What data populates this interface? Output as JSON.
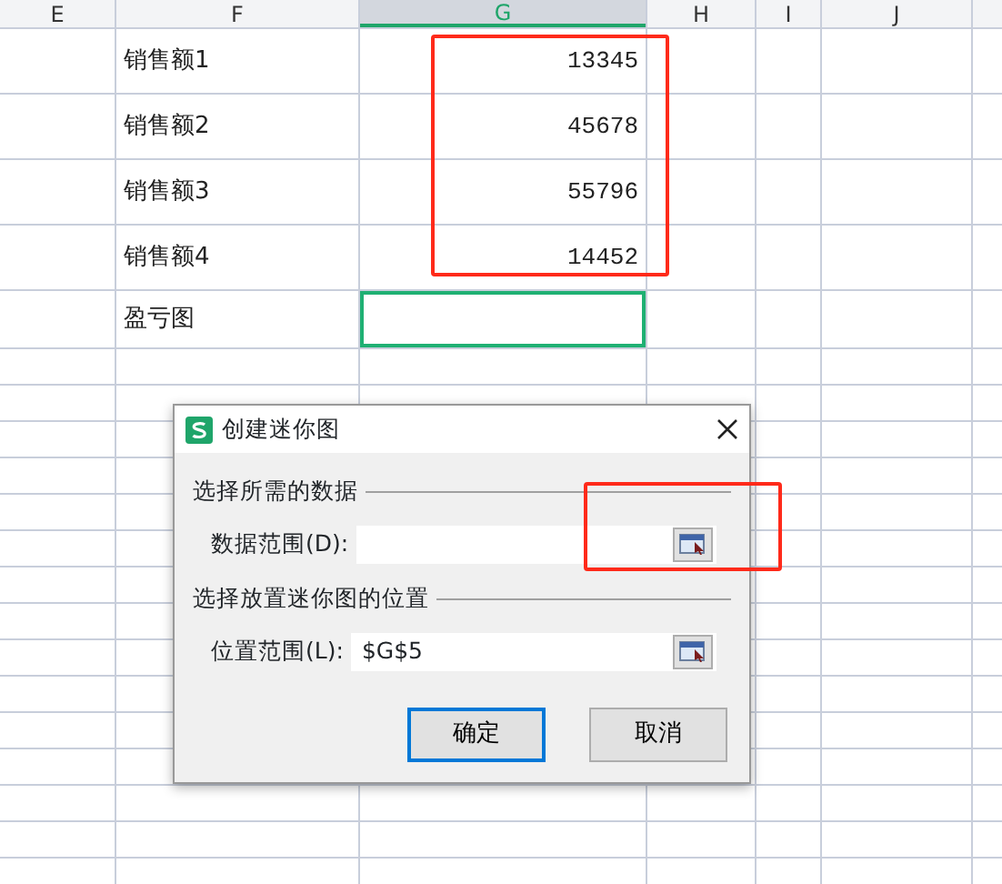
{
  "sheet": {
    "columns": [
      {
        "label": "E",
        "selected": false
      },
      {
        "label": "F",
        "selected": false
      },
      {
        "label": "G",
        "selected": true
      },
      {
        "label": "H",
        "selected": false
      },
      {
        "label": "I",
        "selected": false
      },
      {
        "label": "J",
        "selected": false
      }
    ],
    "rows": [
      {
        "label": "销售额1",
        "value": "13345",
        "selected": false
      },
      {
        "label": "销售额2",
        "value": "45678",
        "selected": false
      },
      {
        "label": "销售额3",
        "value": "55796",
        "selected": false
      },
      {
        "label": "销售额4",
        "value": "14452",
        "selected": false
      },
      {
        "label": "盈亏图",
        "selected": true
      }
    ]
  },
  "dialog": {
    "title": "创建迷你图",
    "sections": [
      {
        "heading": "选择所需的数据",
        "field_label": "数据范围(D):"
      },
      {
        "heading": "选择放置迷你图的位置",
        "field_label": "位置范围(L):",
        "value": "$G$5"
      }
    ],
    "buttons": [
      {
        "label": "确定",
        "default": true
      },
      {
        "label": "取消",
        "default": false
      }
    ]
  },
  "annotations": [
    {
      "kind": "highlight"
    },
    {
      "kind": "highlight"
    }
  ]
}
